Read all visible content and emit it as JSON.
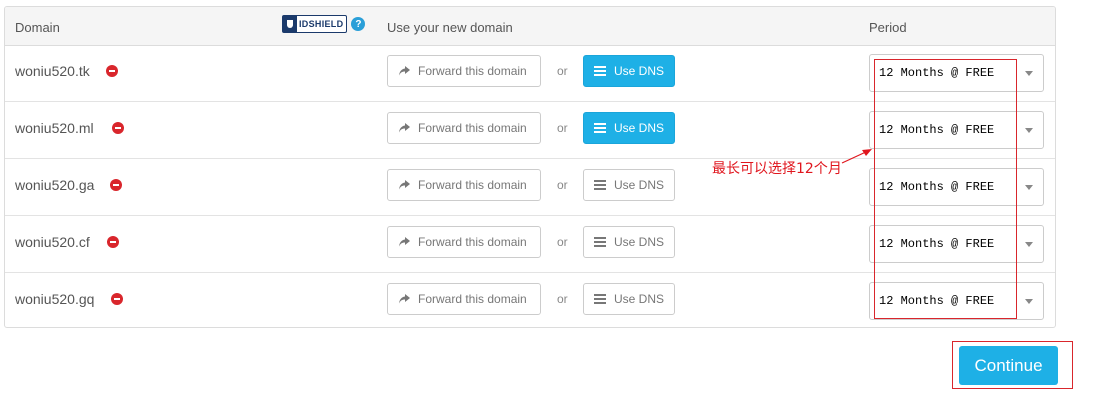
{
  "headers": {
    "domain": "Domain",
    "use_domain": "Use your new domain",
    "period": "Period"
  },
  "idshield": {
    "label": "IDSHIELD",
    "help": "?"
  },
  "rows": [
    {
      "domain": "woniu520.tk",
      "forward_label": "Forward this domain",
      "or": "or",
      "dns_label": "Use DNS",
      "dns_active": true,
      "period": "12 Months @ FREE"
    },
    {
      "domain": "woniu520.ml",
      "forward_label": "Forward this domain",
      "or": "or",
      "dns_label": "Use DNS",
      "dns_active": true,
      "period": "12 Months @ FREE"
    },
    {
      "domain": "woniu520.ga",
      "forward_label": "Forward this domain",
      "or": "or",
      "dns_label": "Use DNS",
      "dns_active": false,
      "period": "12 Months @ FREE"
    },
    {
      "domain": "woniu520.cf",
      "forward_label": "Forward this domain",
      "or": "or",
      "dns_label": "Use DNS",
      "dns_active": false,
      "period": "12 Months @ FREE"
    },
    {
      "domain": "woniu520.gq",
      "forward_label": "Forward this domain",
      "or": "or",
      "dns_label": "Use DNS",
      "dns_active": false,
      "period": "12 Months @ FREE"
    }
  ],
  "annotation": "最长可以选择12个月",
  "continue_label": "Continue",
  "colors": {
    "accent": "#1eb0e6",
    "annotation": "#e0161e",
    "remove": "#d9262c",
    "brand_navy": "#1b3a6b"
  },
  "icons": {
    "forward": "share-arrow-icon",
    "dns": "list-icon",
    "remove": "no-entry-icon",
    "dropdown": "caret-down-icon"
  }
}
